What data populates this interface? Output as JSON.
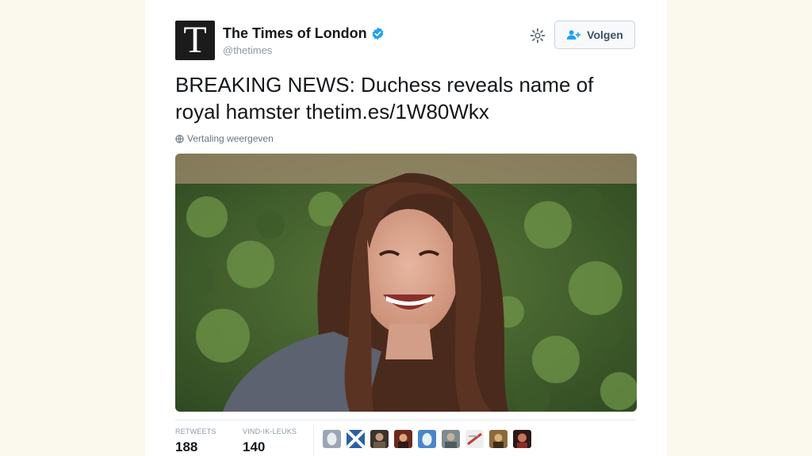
{
  "account": {
    "logo_letter": "T",
    "name": "The Times of London",
    "handle": "@thetimes",
    "verified": true
  },
  "actions": {
    "follow_label": "Volgen",
    "settings_icon": "gear-icon"
  },
  "tweet": {
    "text_main": "BREAKING NEWS: Duchess reveals name of royal hamster ",
    "link": "thetim.es/1W80Wkx",
    "translate_label": "Vertaling weergeven"
  },
  "stats": {
    "retweets_label": "RETWEETS",
    "retweets_value": "188",
    "likes_label": "VIND-IK-LEUKS",
    "likes_value": "140"
  },
  "colors": {
    "verified_blue": "#1da1f2",
    "link_color": "#14171a",
    "background": "#fbf8ee"
  }
}
